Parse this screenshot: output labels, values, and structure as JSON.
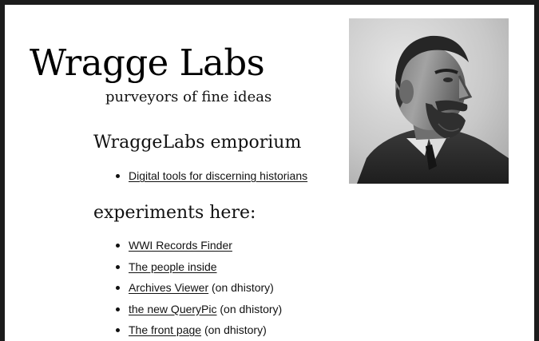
{
  "header": {
    "title": "Wragge Labs",
    "tagline": "purveyors of fine ideas"
  },
  "portrait": {
    "icon": "portrait-photo"
  },
  "emporium": {
    "heading": "WraggeLabs emporium",
    "links": [
      {
        "label": "Digital tools for discerning historians",
        "note": ""
      }
    ]
  },
  "experiments": {
    "heading": "experiments here:",
    "links": [
      {
        "label": "WWI Records Finder",
        "note": ""
      },
      {
        "label": "The people inside",
        "note": ""
      },
      {
        "label": "Archives Viewer",
        "note": " (on dhistory)"
      },
      {
        "label": "the new QueryPic",
        "note": " (on dhistory)"
      },
      {
        "label": "The front page",
        "note": " (on dhistory)"
      }
    ]
  }
}
